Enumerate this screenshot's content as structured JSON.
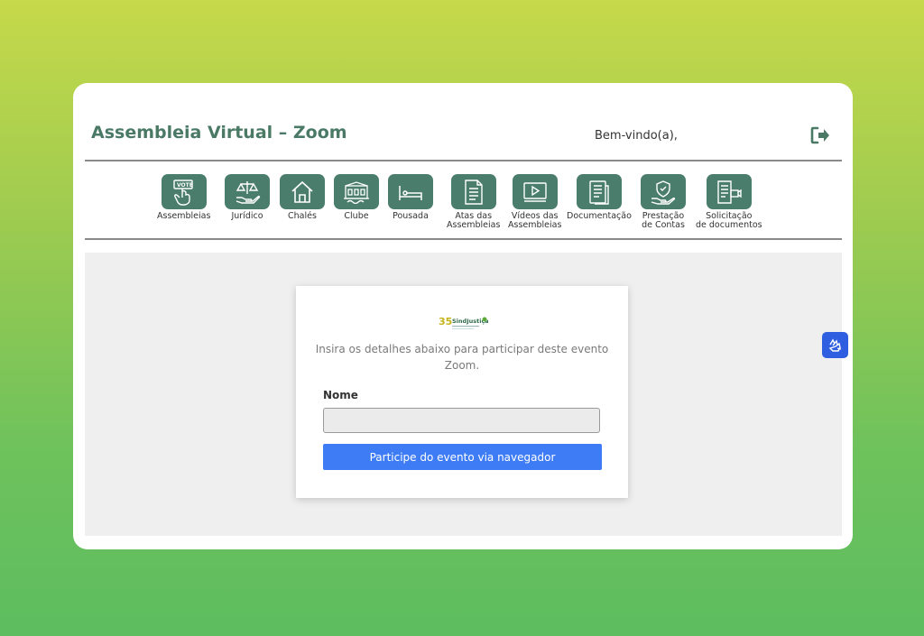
{
  "header": {
    "title": "Assembleia Virtual – Zoom",
    "welcome": "Bem-vindo(a),",
    "logout_icon": "sign-out-icon"
  },
  "nav": {
    "items": [
      {
        "label1": "Assembleias",
        "label2": "",
        "icon": "vote-hand-icon"
      },
      {
        "label1": "Jurídico",
        "label2": "",
        "icon": "scales-hand-icon"
      },
      {
        "label1": "Chalés",
        "label2": "",
        "icon": "house-icon"
      },
      {
        "label1": "Clube",
        "label2": "",
        "icon": "club-building-icon"
      },
      {
        "label1": "Pousada",
        "label2": "",
        "icon": "bed-icon"
      },
      {
        "label1": "Atas das",
        "label2": "Assembleias",
        "icon": "document-icon"
      },
      {
        "label1": "Vídeos das",
        "label2": "Assembleias",
        "icon": "video-icon"
      },
      {
        "label1": "Documentação",
        "label2": "",
        "icon": "clipboard-icon"
      },
      {
        "label1": "Prestação",
        "label2": "de Contas",
        "icon": "shield-hand-icon"
      },
      {
        "label1": "Solicitação",
        "label2": "de documentos",
        "icon": "document-camera-icon"
      }
    ]
  },
  "panel": {
    "logo_text": "SindJustiça",
    "logo_number": "35",
    "description": "Insira os detalhes abaixo para participar deste evento Zoom.",
    "name_label": "Nome",
    "name_value": "",
    "join_button": "Participe do evento via navegador"
  },
  "accessibility": {
    "icon": "sign-language-icon"
  },
  "colors": {
    "accent_green": "#4a7d6c",
    "title_green": "#4a7a66",
    "button_blue": "#3e7cf5",
    "accessibility_blue": "#2f5fe0"
  }
}
